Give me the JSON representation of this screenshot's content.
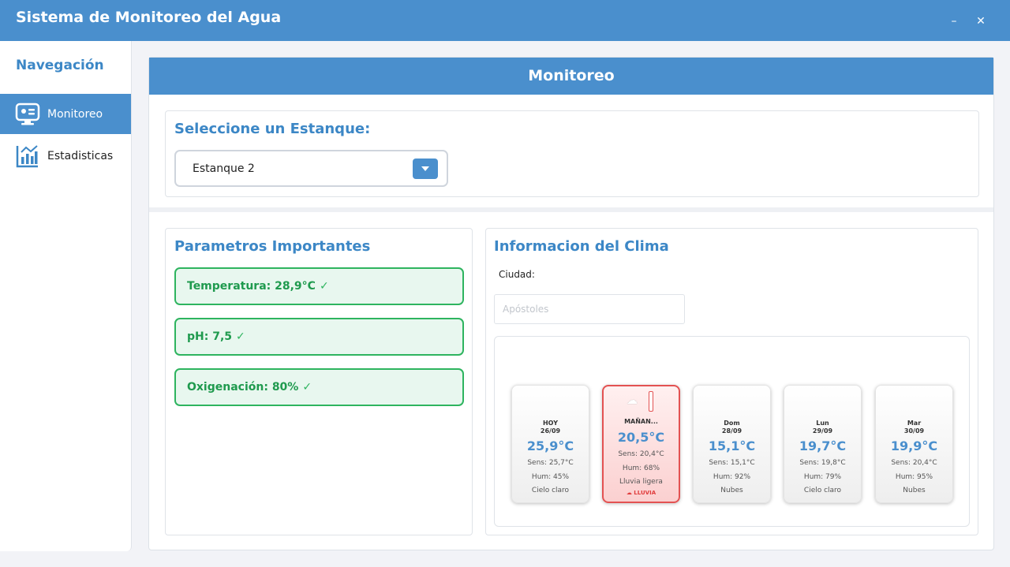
{
  "window": {
    "title": "Sistema de Monitoreo del Agua",
    "minimize_label": "–",
    "close_label": "✕"
  },
  "sidebar": {
    "title": "Navegación",
    "items": [
      {
        "label": "Monitoreo",
        "icon": "monitor-icon",
        "active": true
      },
      {
        "label": "Estadisticas",
        "icon": "chart-icon",
        "active": false
      }
    ]
  },
  "main": {
    "header": "Monitoreo",
    "selector": {
      "title": "Seleccione un Estanque:",
      "selected": "Estanque 2"
    },
    "params": {
      "title": "Parametros Importantes",
      "items": [
        {
          "label": "Temperatura: 28,9°C",
          "status": "✓"
        },
        {
          "label": "pH: 7,5",
          "status": "✓"
        },
        {
          "label": "Oxigenación: 80%",
          "status": "✓"
        }
      ]
    },
    "weather": {
      "title": "Informacion del Clima",
      "city_label": "Ciudad:",
      "city_placeholder": "Apóstoles",
      "days": [
        {
          "name": "HOY",
          "date": "26/09",
          "temp": "25,9°C",
          "feels": "Sens: 25,7°C",
          "humidity": "Hum: 45%",
          "desc": "Cielo claro",
          "alert": ""
        },
        {
          "name": "MAÑAN...",
          "date": "",
          "temp": "20,5°C",
          "feels": "Sens: 20,4°C",
          "humidity": "Hum: 68%",
          "desc": "Lluvia ligera",
          "alert": "☁ LLUVIA"
        },
        {
          "name": "Dom",
          "date": "28/09",
          "temp": "15,1°C",
          "feels": "Sens: 15,1°C",
          "humidity": "Hum: 92%",
          "desc": "Nubes",
          "alert": ""
        },
        {
          "name": "Lun",
          "date": "29/09",
          "temp": "19,7°C",
          "feels": "Sens: 19,8°C",
          "humidity": "Hum: 79%",
          "desc": "Cielo claro",
          "alert": ""
        },
        {
          "name": "Mar",
          "date": "30/09",
          "temp": "19,9°C",
          "feels": "Sens: 20,4°C",
          "humidity": "Hum: 95%",
          "desc": "Nubes",
          "alert": ""
        }
      ]
    }
  },
  "colors": {
    "accent": "#4a8fcd",
    "ok": "#2eb45f",
    "alert": "#e35252"
  }
}
